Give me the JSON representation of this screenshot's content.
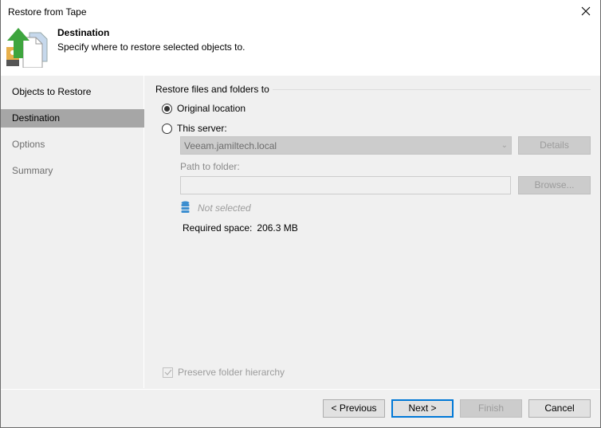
{
  "window": {
    "title": "Restore from Tape",
    "close_icon": "close-icon"
  },
  "header": {
    "icon": "restore-tape-icon",
    "step_title": "Destination",
    "step_description": "Specify where to restore selected objects to."
  },
  "sidebar": {
    "items": [
      {
        "label": "Objects to Restore",
        "state": "normal"
      },
      {
        "label": "Destination",
        "state": "active"
      },
      {
        "label": "Options",
        "state": "disabled"
      },
      {
        "label": "Summary",
        "state": "disabled"
      }
    ]
  },
  "main": {
    "group_label": "Restore files and folders to",
    "options": [
      {
        "label": "Original location",
        "selected": true
      },
      {
        "label": "This server:",
        "selected": false
      }
    ],
    "server_combo": {
      "value": "Veeam.jamiltech.local",
      "enabled": false
    },
    "details_button": "Details",
    "path_label": "Path to folder:",
    "path_input": {
      "value": "",
      "enabled": false
    },
    "browse_button": "Browse...",
    "repository_icon": "database-icon",
    "repository_status": "Not selected",
    "required_space_label": "Required space:",
    "required_space_value": "206.3 MB",
    "preserve_hierarchy": {
      "label": "Preserve folder hierarchy",
      "checked": true,
      "enabled": false
    }
  },
  "footer": {
    "previous": "< Previous",
    "next": "Next >",
    "finish": "Finish",
    "cancel": "Cancel"
  },
  "colors": {
    "accent": "#0078d7",
    "active_nav": "#a6a6a6",
    "background": "#f0f0f0"
  }
}
